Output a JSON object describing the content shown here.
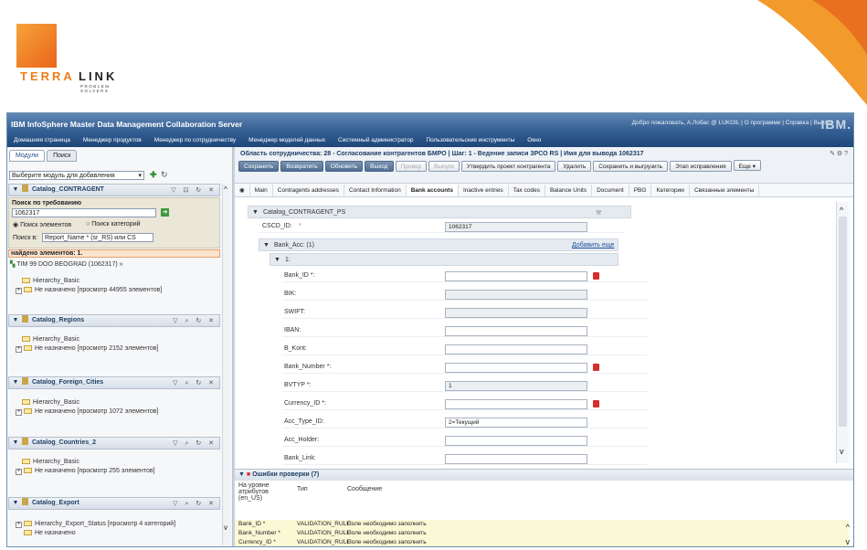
{
  "brand": {
    "logo_text_1": "TERRA",
    "logo_text_2": "LINK",
    "logo_sub": "PROBLEM SOLVERS",
    "colors": {
      "accent": "#f07c1a",
      "nav": "#2f5c92"
    }
  },
  "window": {
    "title": "IBM InfoSphere Master Data Management Collaboration Server",
    "user_links": "Добро пожаловать, A.Лобас @ LUKOIL  |  О программе  |  Справка  |  Выход",
    "ibm": "IBM."
  },
  "menu": [
    "Домашняя страница",
    "Менеджер продуктов",
    "Менеджер по сотрудничеству",
    "Менеджер моделей данных",
    "Системный администратор",
    "Пользовательские инструменты",
    "Окно"
  ],
  "left": {
    "tabs": [
      "Модули",
      "Поиск"
    ],
    "module_select": "Выберите модуль для добавления",
    "catalog1": "Catalog_CONTRAGENT",
    "search_title": "Поиск по требованию",
    "search_value": "1062317",
    "radio1": "Поиск элементов",
    "radio2": "Поиск категорий",
    "search_in_label": "Поиск в:",
    "search_in_value": "Report_Name * (sr_RS) или CS",
    "found": "найдено элементов: 1.",
    "found_item": "TIM 99 DOO BEOGRAD (1062317) »",
    "hierarchy": "Hierarchy_Basic",
    "panels": [
      {
        "title": "Catalog_Regions",
        "unassigned": "Не назначено [просмотр 2152 элементов]"
      },
      {
        "title": "Catalog_Foreign_Cities",
        "unassigned": "Не назначено [просмотр 1072 элементов]"
      },
      {
        "title": "Catalog_Countries_2",
        "unassigned": "Не назначено [просмотр 255 элементов]"
      },
      {
        "title": "Catalog_Export",
        "unassigned": "Hierarchy_Export_Status [просмотр 4 категорий]",
        "second": "Не назначено"
      }
    ],
    "c1_unassigned": "Не назначено [просмотр 44955 элементов]"
  },
  "right": {
    "header": "Область сотрудничества: 28 - Согласование контрагентов БМРО | Шаг: 1 - Ведение записи ЗРСО RS | Имя для вывода 1062317",
    "buttons": [
      "Сохранить",
      "Возвратить",
      "Обновить",
      "Выход",
      "Провер",
      "Выпуск",
      "Утвердить проект контрагента",
      "Удалить",
      "Сохранить и выгрузить",
      "Этап исправления",
      "Еще ▾"
    ],
    "tabs": [
      "Main",
      "Contragents addresses",
      "Contact Information",
      "Bank accounts",
      "Inactive entries",
      "Tax codes",
      "Balance Units",
      "Document",
      "PBG",
      "Категории",
      "Связанные элементы"
    ],
    "form": {
      "group": "Catalog_CONTRAGENT_PS",
      "cscd_label": "CSCD_ID:",
      "cscd_value": "1062317",
      "bank_acc": "Bank_Acc: (1)",
      "add_more": "Добавить еще",
      "item": "1:",
      "fields": [
        {
          "label": "Bank_ID *:",
          "value": "",
          "ro": false,
          "err": true
        },
        {
          "label": "BIK:",
          "value": "",
          "ro": true,
          "err": false
        },
        {
          "label": "SWIFT:",
          "value": "",
          "ro": true,
          "err": false
        },
        {
          "label": "IBAN:",
          "value": "",
          "ro": false,
          "err": false
        },
        {
          "label": "B_Kont:",
          "value": "",
          "ro": false,
          "err": false
        },
        {
          "label": "Bank_Number *:",
          "value": "",
          "ro": false,
          "err": true
        },
        {
          "label": "BVTYP *:",
          "value": "1",
          "ro": true,
          "err": false
        },
        {
          "label": "Currency_ID *:",
          "value": "",
          "ro": false,
          "err": true
        },
        {
          "label": "Acc_Type_ID:",
          "value": "2=Текущий",
          "ro": false,
          "err": false
        },
        {
          "label": "Acc_Holder:",
          "value": "",
          "ro": false,
          "err": false
        },
        {
          "label": "Bank_Link:",
          "value": "",
          "ro": false,
          "err": false
        }
      ]
    },
    "errors": {
      "title": "Ошибки проверки (7)",
      "col1": "На уровне атрибутов (en_US)",
      "col2": "Тип",
      "col3": "Сообщение",
      "rows": [
        {
          "attr": "Bank_ID *",
          "type": "VALIDATION_RULE",
          "msg": "Поле необходимо заполнить"
        },
        {
          "attr": "Bank_Number *",
          "type": "VALIDATION_RULE",
          "msg": "Поле необходимо заполнить"
        },
        {
          "attr": "Currency_ID *",
          "type": "VALIDATION_RULE",
          "msg": "Поле необходимо заполнить"
        }
      ]
    }
  }
}
